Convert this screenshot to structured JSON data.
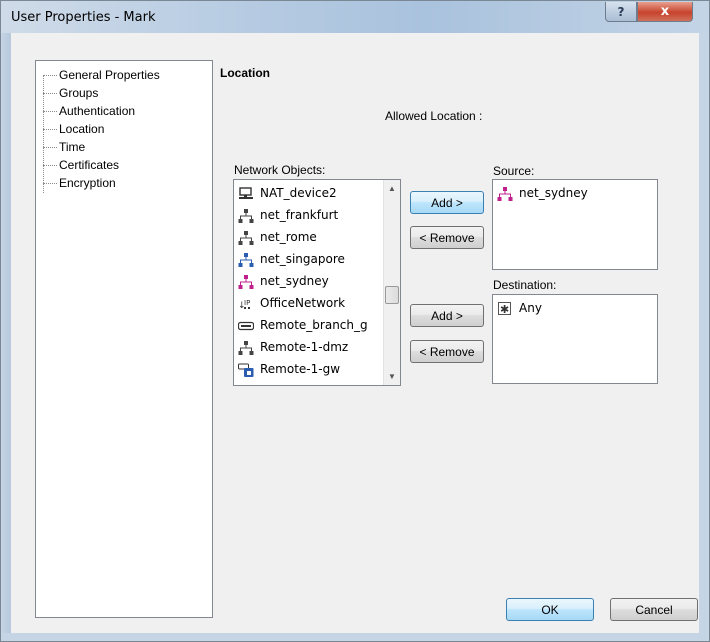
{
  "window": {
    "title": "User Properties - Mark",
    "help_glyph": "?",
    "close_glyph": "x"
  },
  "tree": {
    "items": [
      {
        "label": "General Properties"
      },
      {
        "label": "Groups"
      },
      {
        "label": "Authentication"
      },
      {
        "label": "Location"
      },
      {
        "label": "Time"
      },
      {
        "label": "Certificates"
      },
      {
        "label": "Encryption"
      }
    ]
  },
  "location": {
    "title": "Location",
    "allowed_label": "Allowed Location :",
    "network_objects_label": "Network Objects:",
    "source_label": "Source:",
    "destination_label": "Destination:",
    "network_objects": [
      {
        "label": "NAT_device2",
        "icon": "host-icon"
      },
      {
        "label": "net_frankfurt",
        "icon": "network-icon"
      },
      {
        "label": "net_rome",
        "icon": "network-icon"
      },
      {
        "label": "net_singapore",
        "icon": "network-icon-blue"
      },
      {
        "label": "net_sydney",
        "icon": "network-icon-magenta"
      },
      {
        "label": "OfficeNetwork",
        "icon": "address-range-icon"
      },
      {
        "label": "Remote_branch_g",
        "icon": "gateway-icon"
      },
      {
        "label": "Remote-1-dmz",
        "icon": "network-icon"
      },
      {
        "label": "Remote-1-gw",
        "icon": "gateway-cluster-icon"
      }
    ],
    "source_items": [
      {
        "label": "net_sydney",
        "icon": "network-icon-magenta"
      }
    ],
    "destination_items": [
      {
        "label": "Any",
        "icon": "any-icon"
      }
    ],
    "add_label": "Add >",
    "remove_label": "< Remove"
  },
  "footer": {
    "ok_label": "OK",
    "cancel_label": "Cancel"
  },
  "colors": {
    "default_button": "#bee6fd",
    "network_icon": "#4a4a4a",
    "network_icon_magenta": "#c0208e",
    "network_icon_blue": "#2a5db0"
  }
}
